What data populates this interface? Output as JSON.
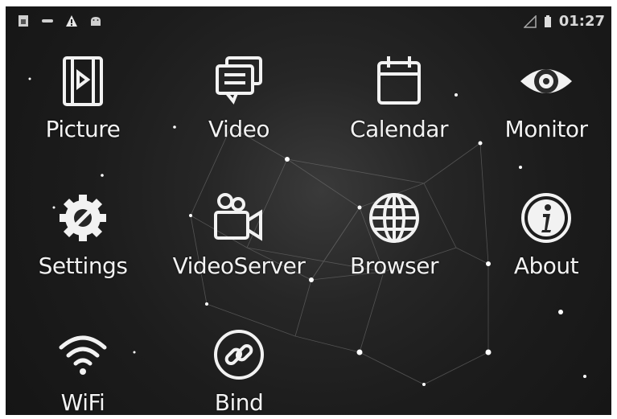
{
  "status_bar": {
    "time": "01:27",
    "left_icons": [
      "sim-icon",
      "minus-icon",
      "warning-icon",
      "android-icon"
    ],
    "right_icons": [
      "signal-icon",
      "battery-icon"
    ]
  },
  "apps": [
    {
      "label": "Picture",
      "icon": "picture-icon"
    },
    {
      "label": "Video",
      "icon": "video-icon"
    },
    {
      "label": "Calendar",
      "icon": "calendar-icon"
    },
    {
      "label": "Monitor",
      "icon": "monitor-icon"
    },
    {
      "label": "Settings",
      "icon": "settings-icon"
    },
    {
      "label": "VideoServer",
      "icon": "videoserver-icon"
    },
    {
      "label": "Browser",
      "icon": "browser-icon"
    },
    {
      "label": "About",
      "icon": "about-icon"
    },
    {
      "label": "WiFi",
      "icon": "wifi-icon"
    },
    {
      "label": "Bind",
      "icon": "bind-icon"
    }
  ],
  "colors": {
    "background": "#1c1c1c",
    "foreground": "#f2f2f2"
  }
}
